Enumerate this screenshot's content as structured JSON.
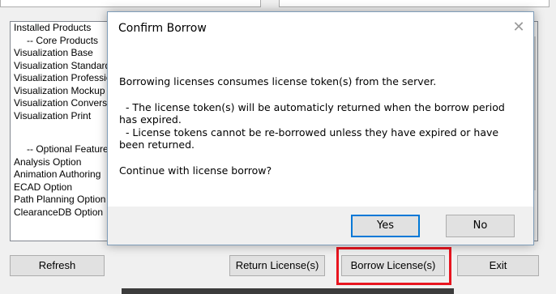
{
  "list": {
    "items": [
      {
        "text": "Installed Products",
        "kind": "hdr"
      },
      {
        "text": "-- Core Products",
        "kind": "sub"
      },
      {
        "text": "Visualization Base",
        "kind": "hdr"
      },
      {
        "text": "Visualization Standard",
        "kind": "hdr"
      },
      {
        "text": "Visualization Professional",
        "kind": "hdr"
      },
      {
        "text": "Visualization Mockup",
        "kind": "hdr"
      },
      {
        "text": "Visualization Conversion",
        "kind": "hdr"
      },
      {
        "text": "Visualization Print",
        "kind": "hdr"
      },
      {
        "text": "",
        "kind": "gap"
      },
      {
        "text": "",
        "kind": "gap"
      },
      {
        "text": "-- Optional Features",
        "kind": "sub"
      },
      {
        "text": "Analysis Option",
        "kind": "hdr"
      },
      {
        "text": "Animation Authoring",
        "kind": "hdr"
      },
      {
        "text": "ECAD Option",
        "kind": "hdr"
      },
      {
        "text": "Path Planning Option",
        "kind": "hdr"
      },
      {
        "text": "ClearanceDB Option",
        "kind": "hdr"
      }
    ]
  },
  "buttons": {
    "refresh": "Refresh",
    "return": "Return License(s)",
    "borrow": "Borrow License(s)",
    "exit": "Exit"
  },
  "dialog": {
    "title": "Confirm Borrow",
    "close_glyph": "✕",
    "line1": "Borrowing licenses consumes license token(s) from the server.",
    "line2": "  - The license token(s) will be automaticly returned when the borrow period has expired.",
    "line3": "  - License tokens cannot be re-borrowed unless they have expired or have been returned.",
    "line4": "Continue with license borrow?",
    "yes": "Yes",
    "no": "No"
  },
  "colors": {
    "highlight": "#e8151f",
    "default_button_border": "#0078d7"
  }
}
